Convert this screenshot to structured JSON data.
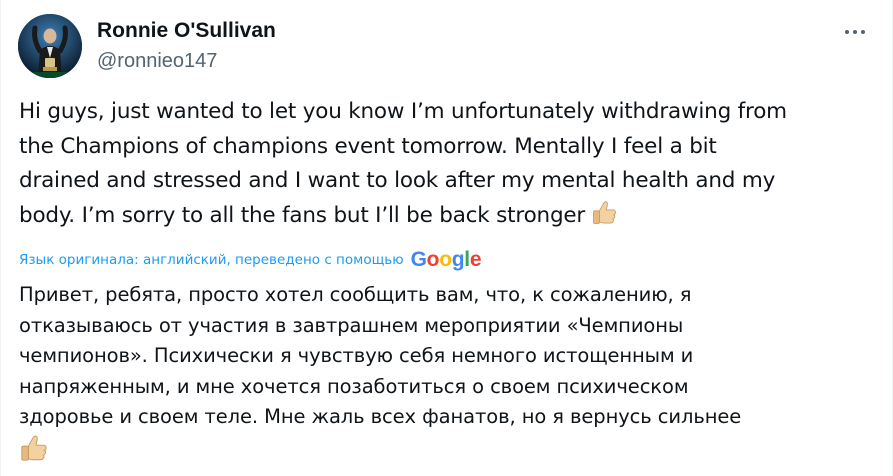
{
  "author": {
    "name": "Ronnie O'Sullivan",
    "handle": "@ronnieo147",
    "avatar_icon": "profile-photo-with-trophy"
  },
  "more_menu": {
    "icon": "more-horizontal-icon"
  },
  "tweet": {
    "lines": [
      "Hi guys, just wanted to let you know I’m unfortunately withdrawing from",
      "the Champions of champions event tomorrow. Mentally I feel a bit",
      "drained and stressed and I want to look after my mental health and my",
      "body. I’m sorry to all the fans but I’ll be back stronger"
    ],
    "emoji": "thumbs-up-light-skin-tone"
  },
  "translation": {
    "label": "Язык оригинала: английский, переведено с помощью",
    "provider_letters": [
      "G",
      "o",
      "o",
      "g",
      "l",
      "e"
    ],
    "lines": [
      "Привет, ребята, просто хотел сообщить вам, что, к сожалению, я",
      "отказываюсь от участия в завтрашнем мероприятии «Чемпионы",
      "чемпионов». Психически я чувствую себя немного истощенным и",
      "напряженным, и мне хочется позаботиться о своем психическом",
      "здоровье и своем теле. Мне жаль всех фанатов, но я вернусь сильнее"
    ],
    "emoji": "thumbs-up-light-skin-tone"
  },
  "colors": {
    "text_primary": "#0f1419",
    "text_secondary": "#536471",
    "link_blue": "#1d9bf0"
  }
}
